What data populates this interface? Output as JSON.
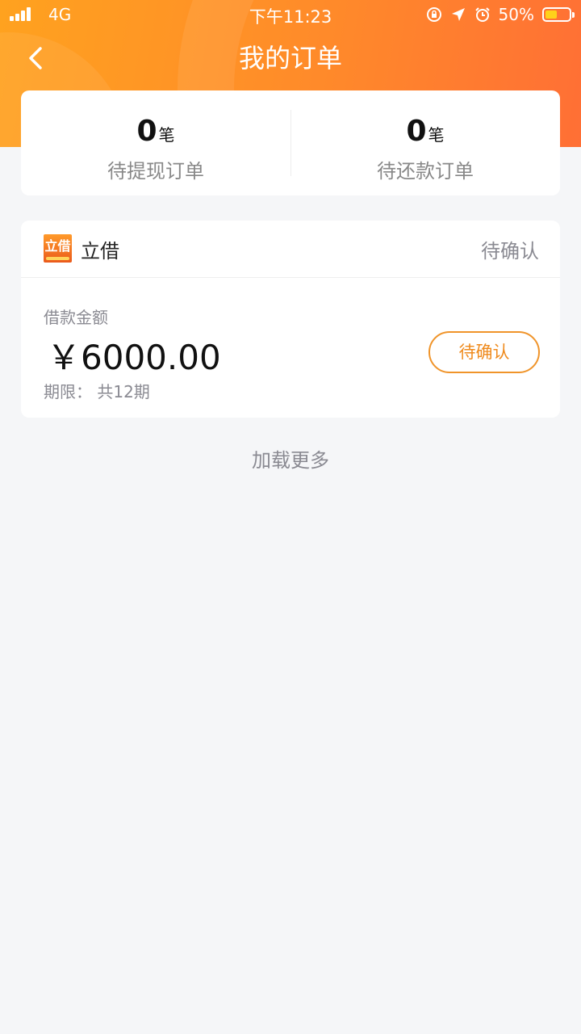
{
  "status_bar": {
    "carrier": "4G",
    "time": "下午11:23",
    "battery_percent": "50%",
    "battery_level": 0.5,
    "icons": [
      "signal-icon",
      "rotation-lock-icon",
      "location-icon",
      "alarm-icon",
      "battery-icon"
    ]
  },
  "header": {
    "title": "我的订单",
    "back_icon": "chevron-left-icon",
    "gradient_colors": [
      "#ffa21f",
      "#ff6f35"
    ]
  },
  "summary": [
    {
      "count": "0",
      "unit": "笔",
      "label": "待提现订单"
    },
    {
      "count": "0",
      "unit": "笔",
      "label": "待还款订单"
    }
  ],
  "order": {
    "lender_logo_text": "立借",
    "lender_name": "立借",
    "status": "待确认",
    "amount_label": "借款金额",
    "amount": "￥6000.00",
    "term": "期限：  共12期",
    "action_label": "待确认",
    "accent_color": "#ef8a1c"
  },
  "load_more": "加载更多"
}
